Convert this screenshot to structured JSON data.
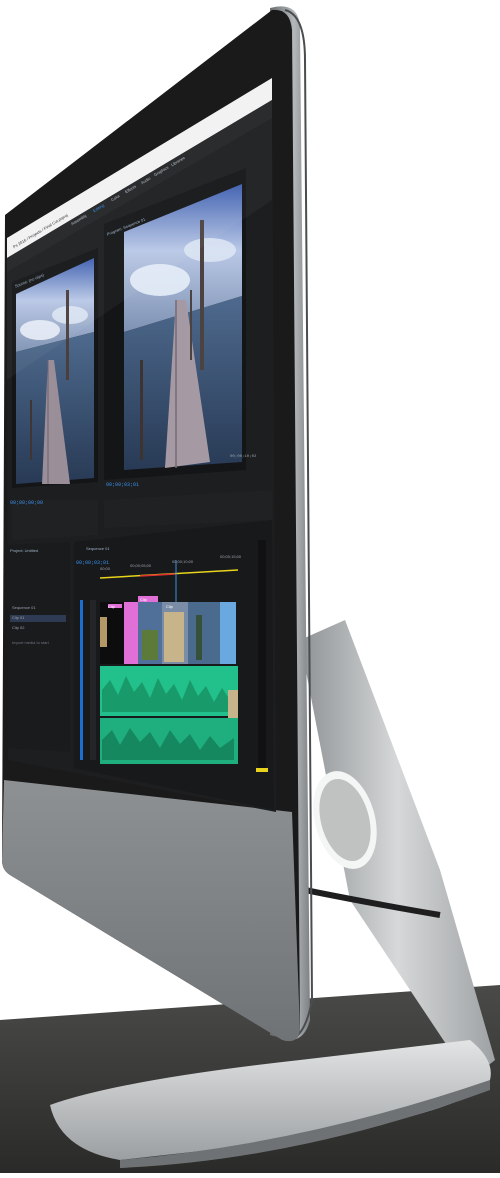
{
  "window": {
    "title": "Ps 2016 / Projects / Final Cut.prproj"
  },
  "menu": {
    "items": [
      "Assembly",
      "Editing",
      "Color",
      "Effects",
      "Audio",
      "Graphics",
      "Libraries"
    ]
  },
  "source_monitor": {
    "tab_label": "Source: (no clips)",
    "timecode": "00;00;00;00"
  },
  "program_monitor": {
    "tab_label": "Program: Sequence 01",
    "timecode_left": "00;00;03;01",
    "timecode_right": "00;00;10;02"
  },
  "project_panel": {
    "tab_label": "Project: Untitled",
    "items": [
      "Sequence 01",
      "Clip 01",
      "Clip 02"
    ],
    "search_placeholder": "Import media to start"
  },
  "timeline": {
    "tab_label": "Sequence 01",
    "timecode": "00;00;03;01",
    "ruler_labels": [
      "00;00",
      "00;00;05;00",
      "00;00;10;00",
      "00;00;15;00"
    ],
    "clip_labels": [
      "Clip",
      "Clip",
      "Clip"
    ]
  },
  "colors": {
    "accent": "#3a8fe8",
    "audio_track": "#22c08a",
    "magenta_clip": "#e070d8",
    "blue_clip": "#6aa8e0"
  }
}
